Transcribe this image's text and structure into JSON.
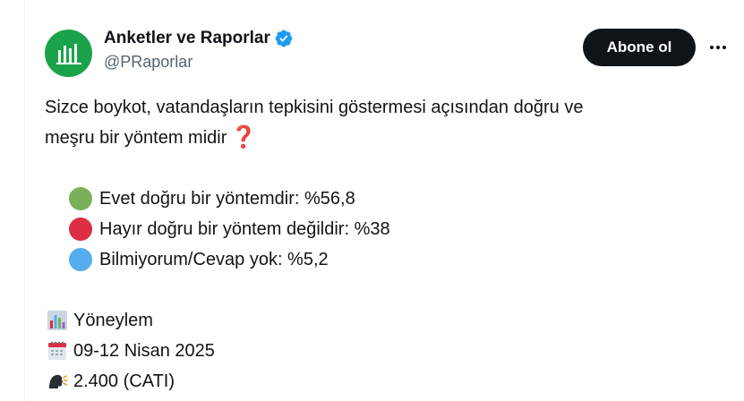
{
  "author": {
    "display_name": "Anketler ve Raporlar",
    "handle": "@PRaporlar",
    "verified": true,
    "avatar_color": "#1aa34a"
  },
  "actions": {
    "follow_label": "Abone ol",
    "more_icon": "more-horizontal-icon"
  },
  "tweet": {
    "question_line1": "Sizce boykot, vatandaşların tepkisini göstermesi açısından doğru ve",
    "question_line2": "meşru bir yöntem midir",
    "question_emoji": "❓",
    "options": [
      {
        "label": "Evet doğru bir yöntemdir: %56,8",
        "color": "#78b159"
      },
      {
        "label": "Hayır doğru bir yöntem değildir: %38",
        "color": "#dd2e44"
      },
      {
        "label": "Bilmiyorum/Cevap yok: %5,2",
        "color": "#55acee"
      }
    ],
    "meta": [
      {
        "icon": "bar-chart-icon",
        "text": "Yöneylem"
      },
      {
        "icon": "calendar-icon",
        "text": "09-12 Nisan 2025"
      },
      {
        "icon": "speaking-head-icon",
        "text": "2.400 (CATI)"
      }
    ]
  },
  "colors": {
    "text": "#0f1419",
    "secondary": "#536471",
    "verified": "#1d9bf0",
    "button_bg": "#0f1419"
  }
}
